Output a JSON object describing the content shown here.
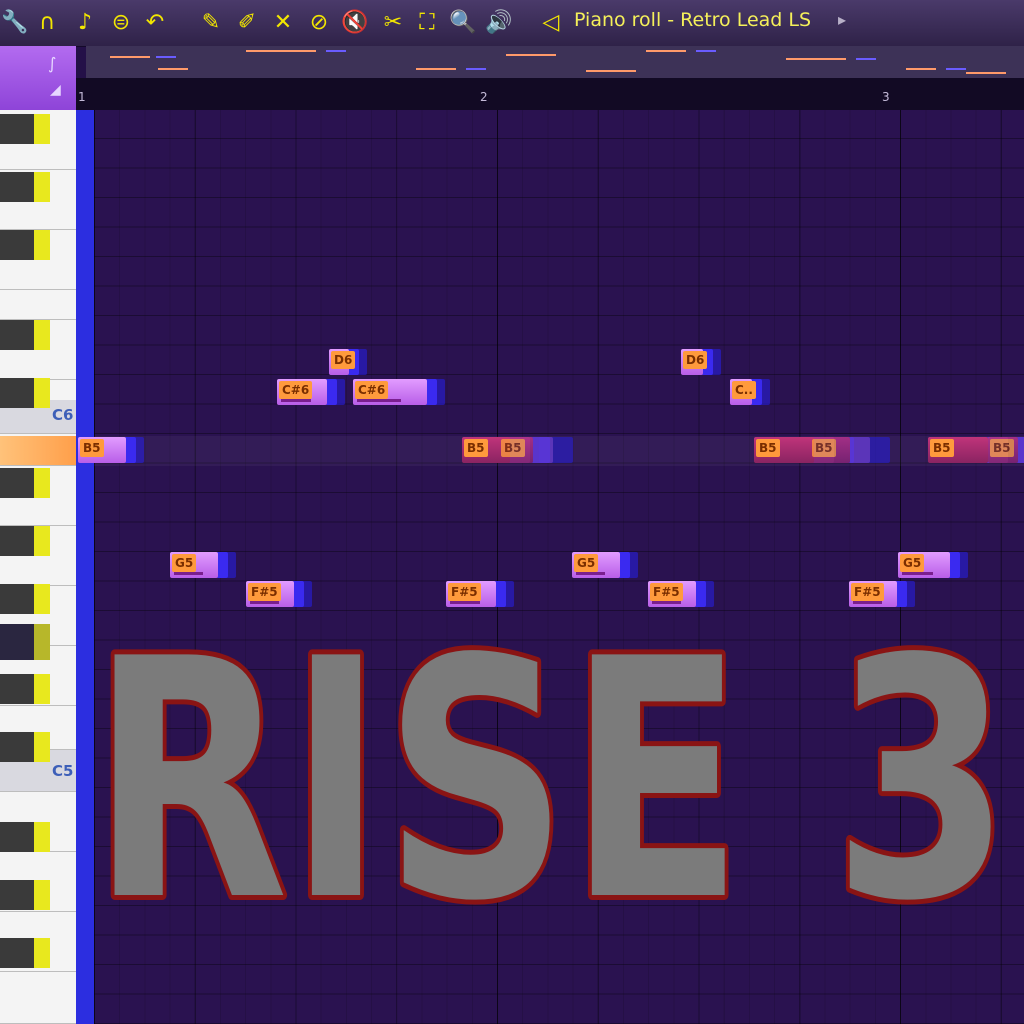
{
  "toolbar": {
    "title": "Piano roll - Retro Lead LS",
    "title_arrow": "▸",
    "tools": [
      {
        "name": "wrench-icon",
        "glyph": "🔧"
      },
      {
        "name": "magnet-icon",
        "glyph": "∩"
      },
      {
        "name": "music-note-icon",
        "glyph": "♪"
      },
      {
        "name": "menu-circle-icon",
        "glyph": "⊜"
      },
      {
        "name": "undo-icon",
        "glyph": "↶"
      },
      {
        "name": "pencil-icon",
        "glyph": "✎"
      },
      {
        "name": "paint-brush-icon",
        "glyph": "✐"
      },
      {
        "name": "eraser-icon",
        "glyph": "✕"
      },
      {
        "name": "delete-icon",
        "glyph": "⊘"
      },
      {
        "name": "mute-icon",
        "glyph": "🔇"
      },
      {
        "name": "slice-icon",
        "glyph": "✂"
      },
      {
        "name": "select-icon",
        "glyph": "⛶"
      },
      {
        "name": "zoom-icon",
        "glyph": "🔍"
      },
      {
        "name": "playback-icon",
        "glyph": "🔊"
      },
      {
        "name": "speaker-icon",
        "glyph": "◁"
      }
    ]
  },
  "corner": {
    "glyph_top": "∫",
    "glyph_bottom": "◢"
  },
  "timeline": {
    "bars": [
      "1",
      "2",
      "3"
    ]
  },
  "keyboard": {
    "labels": [
      "C6",
      "C5"
    ]
  },
  "notes": [
    {
      "label": "D6"
    },
    {
      "label": "C#6"
    },
    {
      "label": "C#6"
    },
    {
      "label": "D6"
    },
    {
      "label": "C.."
    },
    {
      "label": "B5"
    },
    {
      "label": "B5"
    },
    {
      "label": "B5"
    },
    {
      "label": "B5"
    },
    {
      "label": "B5"
    },
    {
      "label": "B5"
    },
    {
      "label": "B5"
    },
    {
      "label": "G5"
    },
    {
      "label": "G5"
    },
    {
      "label": "G5"
    },
    {
      "label": "F#5"
    },
    {
      "label": "F#5"
    },
    {
      "label": "F#5"
    },
    {
      "label": "F#5"
    }
  ],
  "title_art": {
    "text": "RISE 3"
  },
  "colors": {
    "grid_bg": "#2a1250",
    "note_fill": "#c97af0",
    "note_label": "#ff9a3c",
    "playline": "#2c2ee0",
    "title_fill": "#7b7b7b",
    "title_stroke": "#8a1414"
  }
}
